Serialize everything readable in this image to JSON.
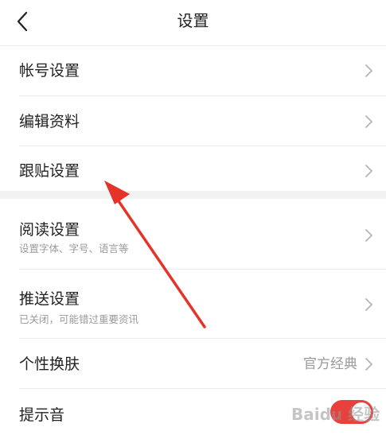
{
  "header": {
    "title": "设置",
    "back_icon": "chevron-left-icon"
  },
  "groups": [
    {
      "items": [
        {
          "label": "帐号设置",
          "icon": "chevron-right-icon"
        },
        {
          "label": "编辑资料",
          "icon": "chevron-right-icon"
        },
        {
          "label": "跟贴设置",
          "icon": "chevron-right-icon"
        }
      ]
    },
    {
      "items": [
        {
          "label": "阅读设置",
          "subtitle": "设置字体、字号、语言等",
          "icon": "chevron-right-icon"
        },
        {
          "label": "推送设置",
          "subtitle": "已关闭，可能错过重要资讯",
          "icon": "chevron-right-icon"
        },
        {
          "label": "个性换肤",
          "value": "官方经典",
          "icon": "chevron-right-icon"
        },
        {
          "label": "提示音",
          "toggle_on": true
        }
      ]
    }
  ],
  "annotation": {
    "type": "arrow",
    "color": "#e5332a"
  },
  "watermark": "Baidu 经验",
  "colors": {
    "accent": "#e8413d",
    "text": "#222222",
    "muted": "#9a9a9a",
    "divider": "#ececec",
    "section_bg": "#f2f2f2"
  }
}
